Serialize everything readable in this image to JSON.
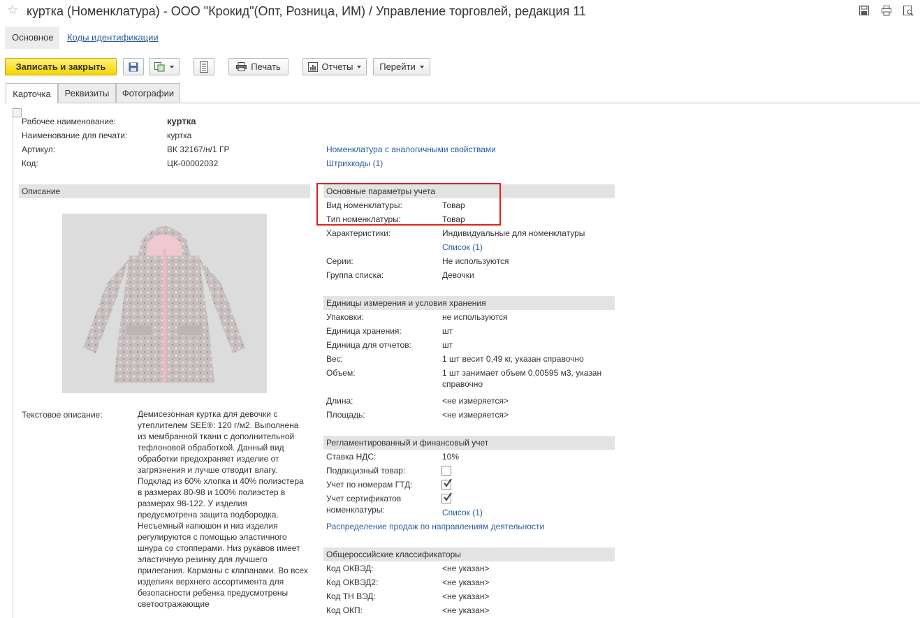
{
  "window": {
    "title": "куртка (Номенклатура) - ООО \"Крокид\"(Опт, Розница, ИМ) / Управление торговлей, редакция 11"
  },
  "nav": {
    "main": "Основное",
    "codes": "Коды идентификации"
  },
  "toolbar": {
    "save_close": "Записать и закрыть",
    "print": "Печать",
    "reports": "Отчеты",
    "goto": "Перейти"
  },
  "tabs": [
    "Карточка",
    "Реквизиты",
    "Фотографии"
  ],
  "header": {
    "work_name_label": "Рабочее наименование:",
    "work_name": "куртка",
    "print_name_label": "Наименование для печати:",
    "print_name": "куртка",
    "article_label": "Артикул:",
    "article": "ВК 32167/н/1 ГР",
    "code_label": "Код:",
    "code": "ЦК-00002032",
    "similar_link": "Номенклатура с аналогичными свойствами",
    "barcodes_link": "Штрихкоды (1)"
  },
  "description": {
    "title": "Описание",
    "text_label": "Текстовое описание:",
    "text": "Демисезонная куртка для девочки с утеплителем SEE®: 120 г/м2. Выполнена из мембранной ткани с дополнительной тефлоновой обработкой. Данный вид обработки предохраняет изделие от загрязнения и лучше отводит влагу. Подклад из 60% хлопка и 40% полиэстера в размерах 80-98 и 100% полиэстер в размерах 98-122. У изделия предусмотрена защита подбородка. Несъемный капюшон и низ изделия регулируются с помощью эластичного шнура со стопперами. Низ рукавов  имеет эластичную резинку для лучшего прилегания. Карманы с клапанами. Во всех изделиях верхнего ассортимента для безопасности ребенка предусмотрены светоотражающие"
  },
  "accounting": {
    "title": "Основные параметры учета",
    "kind_label": "Вид номенклатуры:",
    "kind": "Товар",
    "type_label": "Тип номенклатуры:",
    "type": "Товар",
    "char_label": "Характеристики:",
    "char": "Индивидуальные для номенклатуры",
    "char_link": "Список (1)",
    "series_label": "Серии:",
    "series": "Не используются",
    "group_label": "Группа списка:",
    "group": "Девочки"
  },
  "units": {
    "title": "Единицы измерения и условия хранения",
    "pack_label": "Упаковки:",
    "pack": "не используются",
    "storage_label": "Единица хранения:",
    "storage": "шт",
    "report_label": "Единица для отчетов:",
    "report": "шт",
    "weight_label": "Вес:",
    "weight": "1 шт весит 0,49 кг, указан справочно",
    "volume_label": "Объем:",
    "volume_1": "1 шт занимает объем 0,00595 м3, указан",
    "volume_2": "справочно",
    "length_label": "Длина:",
    "length": "<не измеряется>",
    "area_label": "Площадь:",
    "area": "<не измеряется>"
  },
  "finance": {
    "title": "Регламентированный и финансовый учет",
    "vat_label": "Ставка НДС:",
    "vat": "10%",
    "excise_label": "Подакцизный товар:",
    "excise_checked": false,
    "gtd_label": "Учет по номерам ГТД:",
    "gtd_checked": true,
    "cert_label_1": "Учет сертификатов",
    "cert_label_2": "номенклатуры:",
    "cert_checked": true,
    "cert_link": "Список (1)",
    "distribution_link": "Распределение продаж по направлениям деятельности"
  },
  "classifiers": {
    "title": "Общероссийские классификаторы",
    "okved_label": "Код ОКВЭД:",
    "okved": "<не указан>",
    "okved2_label": "Код ОКВЭД2:",
    "okved2": "<не указан>",
    "tnved_label": "Код ТН ВЭД:",
    "tnved": "<не указан>",
    "okp_label": "Код ОКП:",
    "okp": "<не указан>"
  },
  "colors": {
    "accent_red": "#e0201c",
    "primary_button": "#f6d300",
    "link": "#2a5a9b",
    "jacket": "#c9c2c2",
    "zip": "#f0b8c8"
  }
}
